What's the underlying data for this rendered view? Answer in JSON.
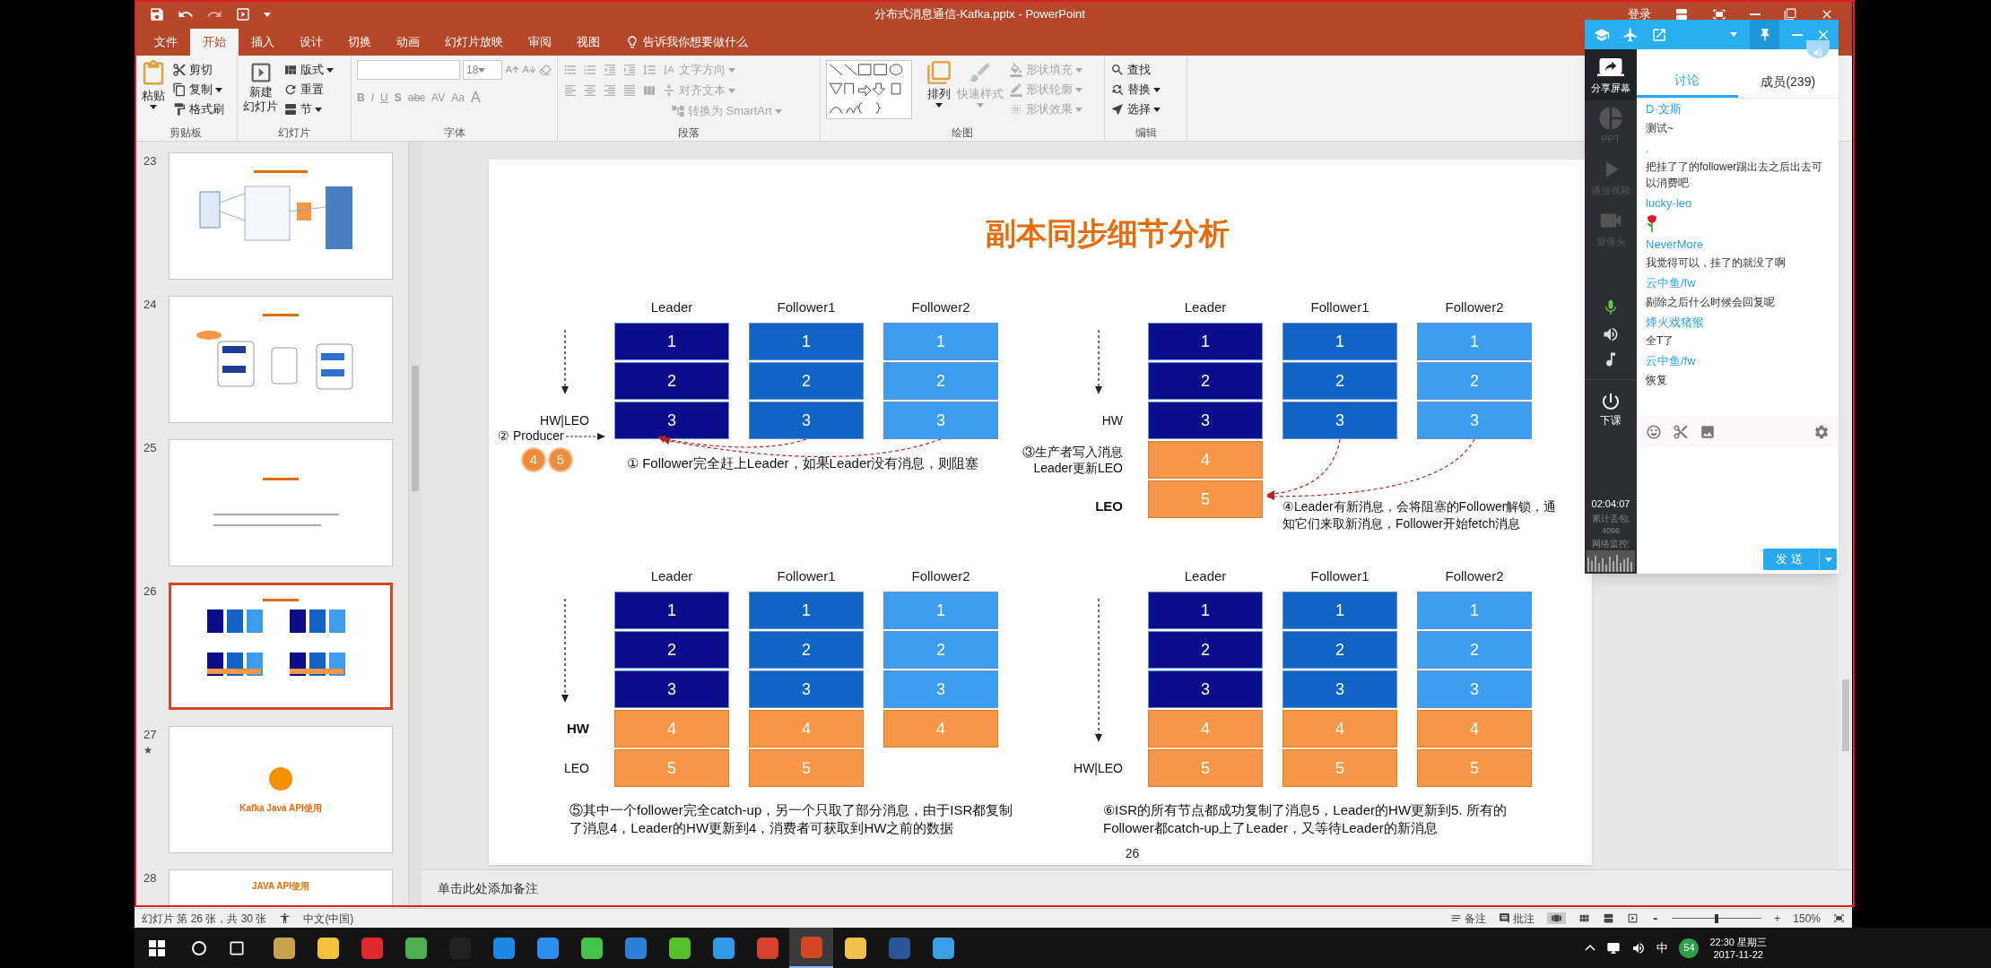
{
  "window": {
    "title": "分布式消息通信-Kafka.pptx  -  PowerPoint",
    "sign_in": "登录"
  },
  "ribbon_tabs": [
    {
      "label": "文件",
      "selected": false
    },
    {
      "label": "开始",
      "selected": true
    },
    {
      "label": "插入",
      "selected": false
    },
    {
      "label": "设计",
      "selected": false
    },
    {
      "label": "切换",
      "selected": false
    },
    {
      "label": "动画",
      "selected": false
    },
    {
      "label": "幻灯片放映",
      "selected": false
    },
    {
      "label": "审阅",
      "selected": false
    },
    {
      "label": "视图",
      "selected": false
    }
  ],
  "tell_me": "告诉我你想要做什么",
  "ribbon": {
    "clipboard": {
      "label": "剪贴板",
      "paste": "粘贴",
      "cut": "剪切",
      "copy": "复制",
      "format_painter": "格式刷"
    },
    "slides": {
      "label": "幻灯片",
      "new_slide": [
        "新建",
        "幻灯片"
      ],
      "layout": "版式",
      "reset": "重置",
      "section": "节"
    },
    "font": {
      "label": "字体",
      "font_size": "18",
      "buttons": [
        {
          "label": "B",
          "kind": "bold"
        },
        {
          "label": "I",
          "kind": "italic"
        },
        {
          "label": "U",
          "kind": "underline"
        },
        {
          "label": "S",
          "kind": "shadow"
        },
        {
          "label": "abc",
          "kind": "strike"
        },
        {
          "label": "AV",
          "kind": "spacing"
        },
        {
          "label": "Aa",
          "kind": "case"
        },
        {
          "label": "A",
          "kind": "color"
        }
      ]
    },
    "paragraph": {
      "label": "段落",
      "text_direction": "文字方向",
      "align_text": "对齐文本",
      "smartart": "转换为 SmartArt"
    },
    "drawing": {
      "label": "绘图",
      "arrange": "排列",
      "quick_styles": "快速样式",
      "fill": "形状填充",
      "outline": "形状轮廓",
      "effects": "形状效果"
    },
    "editing": {
      "label": "编辑",
      "find": "查找",
      "replace": "替换",
      "select": "选择"
    }
  },
  "thumbnails": [
    {
      "number": "23",
      "selected": false,
      "starred": false,
      "kind": "diagram"
    },
    {
      "number": "24",
      "selected": false,
      "starred": false,
      "kind": "flow"
    },
    {
      "number": "25",
      "selected": false,
      "starred": false,
      "kind": "text"
    },
    {
      "number": "26",
      "selected": true,
      "starred": false,
      "kind": "blocks"
    },
    {
      "number": "27",
      "selected": false,
      "starred": true,
      "kind": "title",
      "title": "Kafka Java API使用"
    },
    {
      "number": "28",
      "selected": false,
      "starred": false,
      "kind": "heading",
      "title": "JAVA API使用"
    }
  ],
  "slide": {
    "title": "副本同步细节分析",
    "page_number": "26",
    "quadrants": [
      {
        "follower_arrows": true,
        "producer": {
          "label": "② Producer",
          "messages": [
            "4",
            "5"
          ]
        },
        "note": {
          "text": "① Follower完全赶上Leader，如果Leader没有消息，则阻塞",
          "kind": "caption"
        },
        "columns": [
          {
            "header": "Leader",
            "color": "#0b0d8c",
            "blocks": [
              {
                "label": "1",
                "kind": "replica"
              },
              {
                "label": "2",
                "kind": "replica"
              },
              {
                "label": "3",
                "kind": "replica",
                "side_label": {
                  "text": "HW|LEO",
                  "bold": false
                }
              }
            ]
          },
          {
            "header": "Follower1",
            "color": "#1163c6",
            "blocks": [
              {
                "label": "1",
                "kind": "replica"
              },
              {
                "label": "2",
                "kind": "replica"
              },
              {
                "label": "3",
                "kind": "replica"
              }
            ]
          },
          {
            "header": "Follower2",
            "color": "#3c9cf0",
            "blocks": [
              {
                "label": "1",
                "kind": "replica"
              },
              {
                "label": "2",
                "kind": "replica"
              },
              {
                "label": "3",
                "kind": "replica"
              }
            ]
          }
        ]
      },
      {
        "follower_arrows": true,
        "note": {
          "text": "④Leader有新消息，会将阻塞的Follower解锁，通知它们来取新消息，Follower开始fetch消息",
          "kind": "callout"
        },
        "columns": [
          {
            "header": "Leader",
            "color": "#0b0d8c",
            "blocks": [
              {
                "label": "1",
                "kind": "replica"
              },
              {
                "label": "2",
                "kind": "replica"
              },
              {
                "label": "3",
                "kind": "replica",
                "side_label": {
                  "text": "HW",
                  "bold": false
                }
              },
              {
                "label": "4",
                "kind": "new",
                "side_label": {
                  "text": "③生产者写入消息\nLeader更新LEO",
                  "bold": false
                }
              },
              {
                "label": "5",
                "kind": "new",
                "side_label": {
                  "text": "LEO",
                  "bold": true
                }
              }
            ]
          },
          {
            "header": "Follower1",
            "color": "#1163c6",
            "blocks": [
              {
                "label": "1",
                "kind": "replica"
              },
              {
                "label": "2",
                "kind": "replica"
              },
              {
                "label": "3",
                "kind": "replica"
              }
            ]
          },
          {
            "header": "Follower2",
            "color": "#3c9cf0",
            "blocks": [
              {
                "label": "1",
                "kind": "replica"
              },
              {
                "label": "2",
                "kind": "replica"
              },
              {
                "label": "3",
                "kind": "replica"
              }
            ]
          }
        ]
      },
      {
        "follower_arrows": false,
        "note": {
          "text": "⑤其中一个follower完全catch-up，另一个只取了部分消息，由于ISR都复制了消息4，Leader的HW更新到4，消费者可获取到HW之前的数据",
          "kind": "caption"
        },
        "columns": [
          {
            "header": "Leader",
            "color": "#0b0d8c",
            "blocks": [
              {
                "label": "1",
                "kind": "replica"
              },
              {
                "label": "2",
                "kind": "replica"
              },
              {
                "label": "3",
                "kind": "replica"
              },
              {
                "label": "4",
                "kind": "new",
                "side_label": {
                  "text": "HW",
                  "bold": true
                }
              },
              {
                "label": "5",
                "kind": "new",
                "side_label": {
                  "text": "LEO",
                  "bold": false
                }
              }
            ]
          },
          {
            "header": "Follower1",
            "color": "#1163c6",
            "blocks": [
              {
                "label": "1",
                "kind": "replica"
              },
              {
                "label": "2",
                "kind": "replica"
              },
              {
                "label": "3",
                "kind": "replica"
              },
              {
                "label": "4",
                "kind": "new"
              },
              {
                "label": "5",
                "kind": "new"
              }
            ]
          },
          {
            "header": "Follower2",
            "color": "#3c9cf0",
            "blocks": [
              {
                "label": "1",
                "kind": "replica"
              },
              {
                "label": "2",
                "kind": "replica"
              },
              {
                "label": "3",
                "kind": "replica"
              },
              {
                "label": "4",
                "kind": "new"
              }
            ]
          }
        ]
      },
      {
        "follower_arrows": false,
        "note": {
          "text": "⑥ISR的所有节点都成功复制了消息5，Leader的HW更新到5. 所有的Follower都catch-up上了Leader，又等待Leader的新消息",
          "kind": "caption"
        },
        "columns": [
          {
            "header": "Leader",
            "color": "#0b0d8c",
            "blocks": [
              {
                "label": "1",
                "kind": "replica"
              },
              {
                "label": "2",
                "kind": "replica"
              },
              {
                "label": "3",
                "kind": "replica"
              },
              {
                "label": "4",
                "kind": "new"
              },
              {
                "label": "5",
                "kind": "new",
                "side_label": {
                  "text": "HW|LEO",
                  "bold": false
                }
              }
            ]
          },
          {
            "header": "Follower1",
            "color": "#1163c6",
            "blocks": [
              {
                "label": "1",
                "kind": "replica"
              },
              {
                "label": "2",
                "kind": "replica"
              },
              {
                "label": "3",
                "kind": "replica"
              },
              {
                "label": "4",
                "kind": "new"
              },
              {
                "label": "5",
                "kind": "new"
              }
            ]
          },
          {
            "header": "Follower2",
            "color": "#3c9cf0",
            "blocks": [
              {
                "label": "1",
                "kind": "replica"
              },
              {
                "label": "2",
                "kind": "replica"
              },
              {
                "label": "3",
                "kind": "replica"
              },
              {
                "label": "4",
                "kind": "new"
              },
              {
                "label": "5",
                "kind": "new"
              }
            ]
          }
        ]
      }
    ]
  },
  "notes_placeholder": "单击此处添加备注",
  "status_bar": {
    "slide_info": "幻灯片 第 26 张，共 30 张",
    "language": "中文(中国)",
    "notes": "备注",
    "comments": "批注",
    "zoom_minus": "-",
    "zoom_plus": "+",
    "zoom": "150%",
    "zoom_slider": {
      "level": 0.5
    }
  },
  "chat": {
    "tabs": [
      {
        "label": "讨论",
        "selected": true
      },
      {
        "label": "成员(239)",
        "selected": false
      }
    ],
    "tools": [
      {
        "label": "分享屏幕",
        "enabled": true,
        "kind": "share"
      },
      {
        "label": "PPT",
        "enabled": false,
        "kind": "ppt"
      },
      {
        "label": "播放视频",
        "enabled": false,
        "kind": "video"
      },
      {
        "label": "摄像头",
        "enabled": false,
        "kind": "camera"
      }
    ],
    "end_class": "下课",
    "timer": "02:04:07",
    "packet_loss_label": "累计丢包:",
    "packet_loss": "4096",
    "network_label": "网络监控:",
    "messages": [
      {
        "sender": "D·文斯",
        "kind": "text",
        "text": "测试~"
      },
      {
        "sender": ".",
        "kind": "text",
        "text": "把挂了了的follower踢出去之后出去可以消费吧"
      },
      {
        "sender": "lucky-leo",
        "kind": "sticker"
      },
      {
        "sender": "NeverMore",
        "kind": "text",
        "text": "我觉得可以，挂了的就没了啊"
      },
      {
        "sender": "云中鱼/fw",
        "kind": "text",
        "text": "剔除之后什么时候会回复呢"
      },
      {
        "sender": "烽火戏猪猴",
        "kind": "text",
        "text": "全T了"
      },
      {
        "sender": "云中鱼/fw",
        "kind": "text",
        "text": "恢复"
      }
    ],
    "send": "发送"
  },
  "taskbar": {
    "apps": [
      {
        "color": "#c8a24a",
        "selected": false
      },
      {
        "color": "#f3c13a",
        "selected": false
      },
      {
        "color": "#e0282e",
        "selected": false
      },
      {
        "color": "#4caf50",
        "selected": false
      },
      {
        "color": "#222222",
        "selected": false
      },
      {
        "color": "#1e88e5",
        "selected": false
      },
      {
        "color": "#2b8ff0",
        "selected": false
      },
      {
        "color": "#45c24a",
        "selected": false
      },
      {
        "color": "#2d7fd8",
        "selected": false
      },
      {
        "color": "#56c02a",
        "selected": false
      },
      {
        "color": "#2f9be8",
        "selected": false
      },
      {
        "color": "#d9412f",
        "selected": false
      },
      {
        "color": "#d24726",
        "selected": true
      },
      {
        "color": "#f2c04b",
        "selected": false
      },
      {
        "color": "#2b579a",
        "selected": false
      },
      {
        "color": "#3aa0e6",
        "selected": false
      }
    ],
    "ime": "中",
    "badge": "54",
    "time": "22:30 星期三",
    "date": "2017-11-22"
  }
}
